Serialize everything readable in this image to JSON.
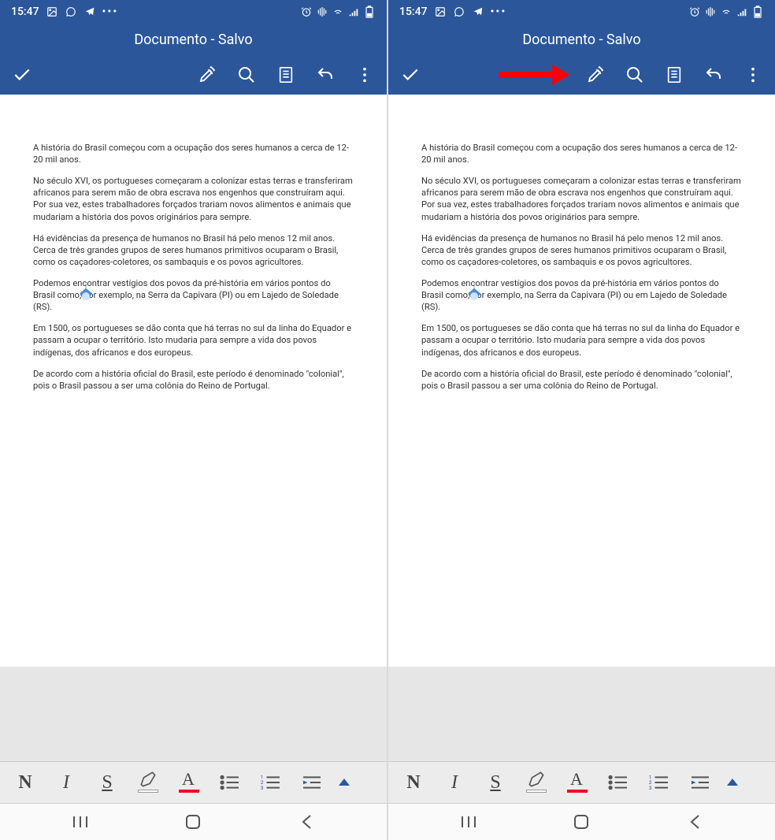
{
  "status": {
    "time": "15:47",
    "icons_left": [
      "gallery-icon",
      "whatsapp-icon",
      "telegram-icon",
      "more-icon"
    ],
    "icons_right": [
      "alarm-icon",
      "vibrate-icon",
      "wifi-icon",
      "signal-icon",
      "battery-icon"
    ]
  },
  "title": "Documento - Salvo",
  "toolbar": {
    "confirm": "✓",
    "icons": [
      "pen-format-icon",
      "search-icon",
      "reading-icon",
      "undo-icon",
      "menu-icon"
    ]
  },
  "document": {
    "p1": "A história do Brasil começou com a ocupação dos seres humanos a cerca de 12-20 mil anos.",
    "p2": "No século XVI, os portugueses começaram a colonizar estas terras e transferiram africanos para serem mão de obra escrava nos engenhos que construíram aqui. Por sua vez, estes trabalhadores forçados trariam novos alimentos e animais que mudariam a história dos povos originários para sempre.",
    "p3": "Há evidências da presença de humanos no Brasil há pelo menos 12 mil anos. Cerca de três grandes grupos de seres humanos primitivos ocuparam o Brasil, como os caçadores-coletores, os sambaquis e os povos agricultores.",
    "p4": "Podemos encontrar vestígios dos povos da pré-história em vários pontos do Brasil como, por exemplo, na Serra da Capivara (PI) ou em Lajedo de Soledade (RS).",
    "p5": "Em 1500, os portugueses se dão conta que há terras no sul da linha do Equador e passam a ocupar o território. Isto mudaria para sempre a vida dos povos indígenas, dos africanos e dos europeus.",
    "p6": "De acordo com a história oficial do Brasil, este período é denominado \"colonial\", pois o Brasil passou a ser uma colônia do Reino de Portugal."
  },
  "format": {
    "bold": "N",
    "italic": "I",
    "underline": "S",
    "font_letter": "A"
  },
  "annotation": {
    "show_arrow_on_right": true,
    "arrow_color": "#ff0000"
  }
}
